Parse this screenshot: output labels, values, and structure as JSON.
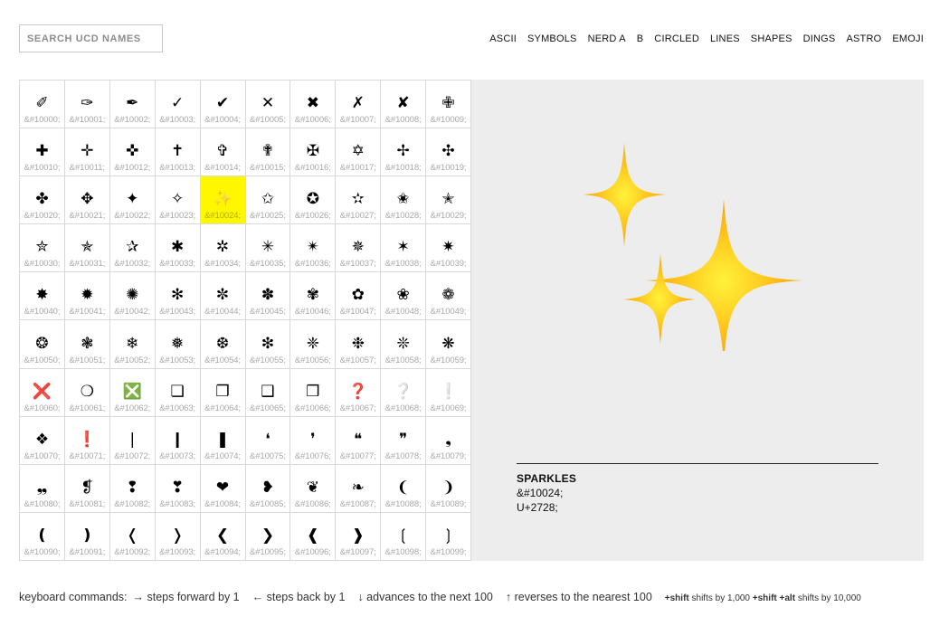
{
  "search": {
    "placeholder": "SEARCH UCD NAMES"
  },
  "nav": [
    "ASCII",
    "SYMBOLS",
    "NERD A",
    "B",
    "CIRCLED",
    "LINES",
    "SHAPES",
    "DINGS",
    "ASTRO",
    "EMOJI"
  ],
  "grid": {
    "selected_index": 24,
    "cells": [
      {
        "glyph": "✐",
        "code": "&#10000;"
      },
      {
        "glyph": "✑",
        "code": "&#10001;"
      },
      {
        "glyph": "✒",
        "code": "&#10002;"
      },
      {
        "glyph": "✓",
        "code": "&#10003;"
      },
      {
        "glyph": "✔",
        "code": "&#10004;"
      },
      {
        "glyph": "✕",
        "code": "&#10005;"
      },
      {
        "glyph": "✖",
        "code": "&#10006;"
      },
      {
        "glyph": "✗",
        "code": "&#10007;"
      },
      {
        "glyph": "✘",
        "code": "&#10008;"
      },
      {
        "glyph": "✙",
        "code": "&#10009;"
      },
      {
        "glyph": "✚",
        "code": "&#10010;"
      },
      {
        "glyph": "✛",
        "code": "&#10011;"
      },
      {
        "glyph": "✜",
        "code": "&#10012;"
      },
      {
        "glyph": "✝",
        "code": "&#10013;"
      },
      {
        "glyph": "✞",
        "code": "&#10014;"
      },
      {
        "glyph": "✟",
        "code": "&#10015;"
      },
      {
        "glyph": "✠",
        "code": "&#10016;"
      },
      {
        "glyph": "✡",
        "code": "&#10017;"
      },
      {
        "glyph": "✢",
        "code": "&#10018;"
      },
      {
        "glyph": "✣",
        "code": "&#10019;"
      },
      {
        "glyph": "✤",
        "code": "&#10020;"
      },
      {
        "glyph": "✥",
        "code": "&#10021;"
      },
      {
        "glyph": "✦",
        "code": "&#10022;"
      },
      {
        "glyph": "✧",
        "code": "&#10023;"
      },
      {
        "glyph": "✨",
        "code": "&#10024;"
      },
      {
        "glyph": "✩",
        "code": "&#10025;"
      },
      {
        "glyph": "✪",
        "code": "&#10026;"
      },
      {
        "glyph": "✫",
        "code": "&#10027;"
      },
      {
        "glyph": "✬",
        "code": "&#10028;"
      },
      {
        "glyph": "✭",
        "code": "&#10029;"
      },
      {
        "glyph": "✮",
        "code": "&#10030;"
      },
      {
        "glyph": "✯",
        "code": "&#10031;"
      },
      {
        "glyph": "✰",
        "code": "&#10032;"
      },
      {
        "glyph": "✱",
        "code": "&#10033;"
      },
      {
        "glyph": "✲",
        "code": "&#10034;"
      },
      {
        "glyph": "✳",
        "code": "&#10035;"
      },
      {
        "glyph": "✴",
        "code": "&#10036;"
      },
      {
        "glyph": "✵",
        "code": "&#10037;"
      },
      {
        "glyph": "✶",
        "code": "&#10038;"
      },
      {
        "glyph": "✷",
        "code": "&#10039;"
      },
      {
        "glyph": "✸",
        "code": "&#10040;"
      },
      {
        "glyph": "✹",
        "code": "&#10041;"
      },
      {
        "glyph": "✺",
        "code": "&#10042;"
      },
      {
        "glyph": "✻",
        "code": "&#10043;"
      },
      {
        "glyph": "✼",
        "code": "&#10044;"
      },
      {
        "glyph": "✽",
        "code": "&#10045;"
      },
      {
        "glyph": "✾",
        "code": "&#10046;"
      },
      {
        "glyph": "✿",
        "code": "&#10047;"
      },
      {
        "glyph": "❀",
        "code": "&#10048;"
      },
      {
        "glyph": "❁",
        "code": "&#10049;"
      },
      {
        "glyph": "❂",
        "code": "&#10050;"
      },
      {
        "glyph": "❃",
        "code": "&#10051;"
      },
      {
        "glyph": "❄",
        "code": "&#10052;"
      },
      {
        "glyph": "❅",
        "code": "&#10053;"
      },
      {
        "glyph": "❆",
        "code": "&#10054;"
      },
      {
        "glyph": "❇",
        "code": "&#10055;"
      },
      {
        "glyph": "❈",
        "code": "&#10056;"
      },
      {
        "glyph": "❉",
        "code": "&#10057;"
      },
      {
        "glyph": "❊",
        "code": "&#10058;"
      },
      {
        "glyph": "❋",
        "code": "&#10059;"
      },
      {
        "glyph": "❌",
        "code": "&#10060;"
      },
      {
        "glyph": "❍",
        "code": "&#10061;"
      },
      {
        "glyph": "❎",
        "code": "&#10062;"
      },
      {
        "glyph": "❏",
        "code": "&#10063;"
      },
      {
        "glyph": "❐",
        "code": "&#10064;"
      },
      {
        "glyph": "❑",
        "code": "&#10065;"
      },
      {
        "glyph": "❒",
        "code": "&#10066;"
      },
      {
        "glyph": "❓",
        "code": "&#10067;"
      },
      {
        "glyph": "❔",
        "code": "&#10068;"
      },
      {
        "glyph": "❕",
        "code": "&#10069;"
      },
      {
        "glyph": "❖",
        "code": "&#10070;"
      },
      {
        "glyph": "❗",
        "code": "&#10071;"
      },
      {
        "glyph": "❘",
        "code": "&#10072;"
      },
      {
        "glyph": "❙",
        "code": "&#10073;"
      },
      {
        "glyph": "❚",
        "code": "&#10074;"
      },
      {
        "glyph": "❛",
        "code": "&#10075;"
      },
      {
        "glyph": "❜",
        "code": "&#10076;"
      },
      {
        "glyph": "❝",
        "code": "&#10077;"
      },
      {
        "glyph": "❞",
        "code": "&#10078;"
      },
      {
        "glyph": "❟",
        "code": "&#10079;"
      },
      {
        "glyph": "❠",
        "code": "&#10080;"
      },
      {
        "glyph": "❡",
        "code": "&#10081;"
      },
      {
        "glyph": "❢",
        "code": "&#10082;"
      },
      {
        "glyph": "❣",
        "code": "&#10083;"
      },
      {
        "glyph": "❤",
        "code": "&#10084;"
      },
      {
        "glyph": "❥",
        "code": "&#10085;"
      },
      {
        "glyph": "❦",
        "code": "&#10086;"
      },
      {
        "glyph": "❧",
        "code": "&#10087;"
      },
      {
        "glyph": "❨",
        "code": "&#10088;"
      },
      {
        "glyph": "❩",
        "code": "&#10089;"
      },
      {
        "glyph": "❪",
        "code": "&#10090;"
      },
      {
        "glyph": "❫",
        "code": "&#10091;"
      },
      {
        "glyph": "❬",
        "code": "&#10092;"
      },
      {
        "glyph": "❭",
        "code": "&#10093;"
      },
      {
        "glyph": "❮",
        "code": "&#10094;"
      },
      {
        "glyph": "❯",
        "code": "&#10095;"
      },
      {
        "glyph": "❰",
        "code": "&#10096;"
      },
      {
        "glyph": "❱",
        "code": "&#10097;"
      },
      {
        "glyph": "❲",
        "code": "&#10098;"
      },
      {
        "glyph": "❳",
        "code": "&#10099;"
      }
    ]
  },
  "preview": {
    "icon": "sparkles-icon",
    "name": "SPARKLES",
    "html_code": "&#10024;",
    "unicode": "U+2728;",
    "colors": {
      "sparkle_outer": "#f59b00",
      "sparkle_inner": "#fff23a",
      "selected_cell": "#fff700",
      "panel": "#ededed"
    }
  },
  "footer": {
    "label": "keyboard commands:",
    "forward": "→ steps forward by 1",
    "back": "← steps back by 1",
    "down": "↓ advances to the next 100",
    "up": "↑ reverses to the nearest 100",
    "shift_key": "+shift",
    "shift_text": "shifts by 1,000",
    "shift_alt_key": "+shift +alt",
    "shift_alt_text": "shifts by 10,000"
  }
}
